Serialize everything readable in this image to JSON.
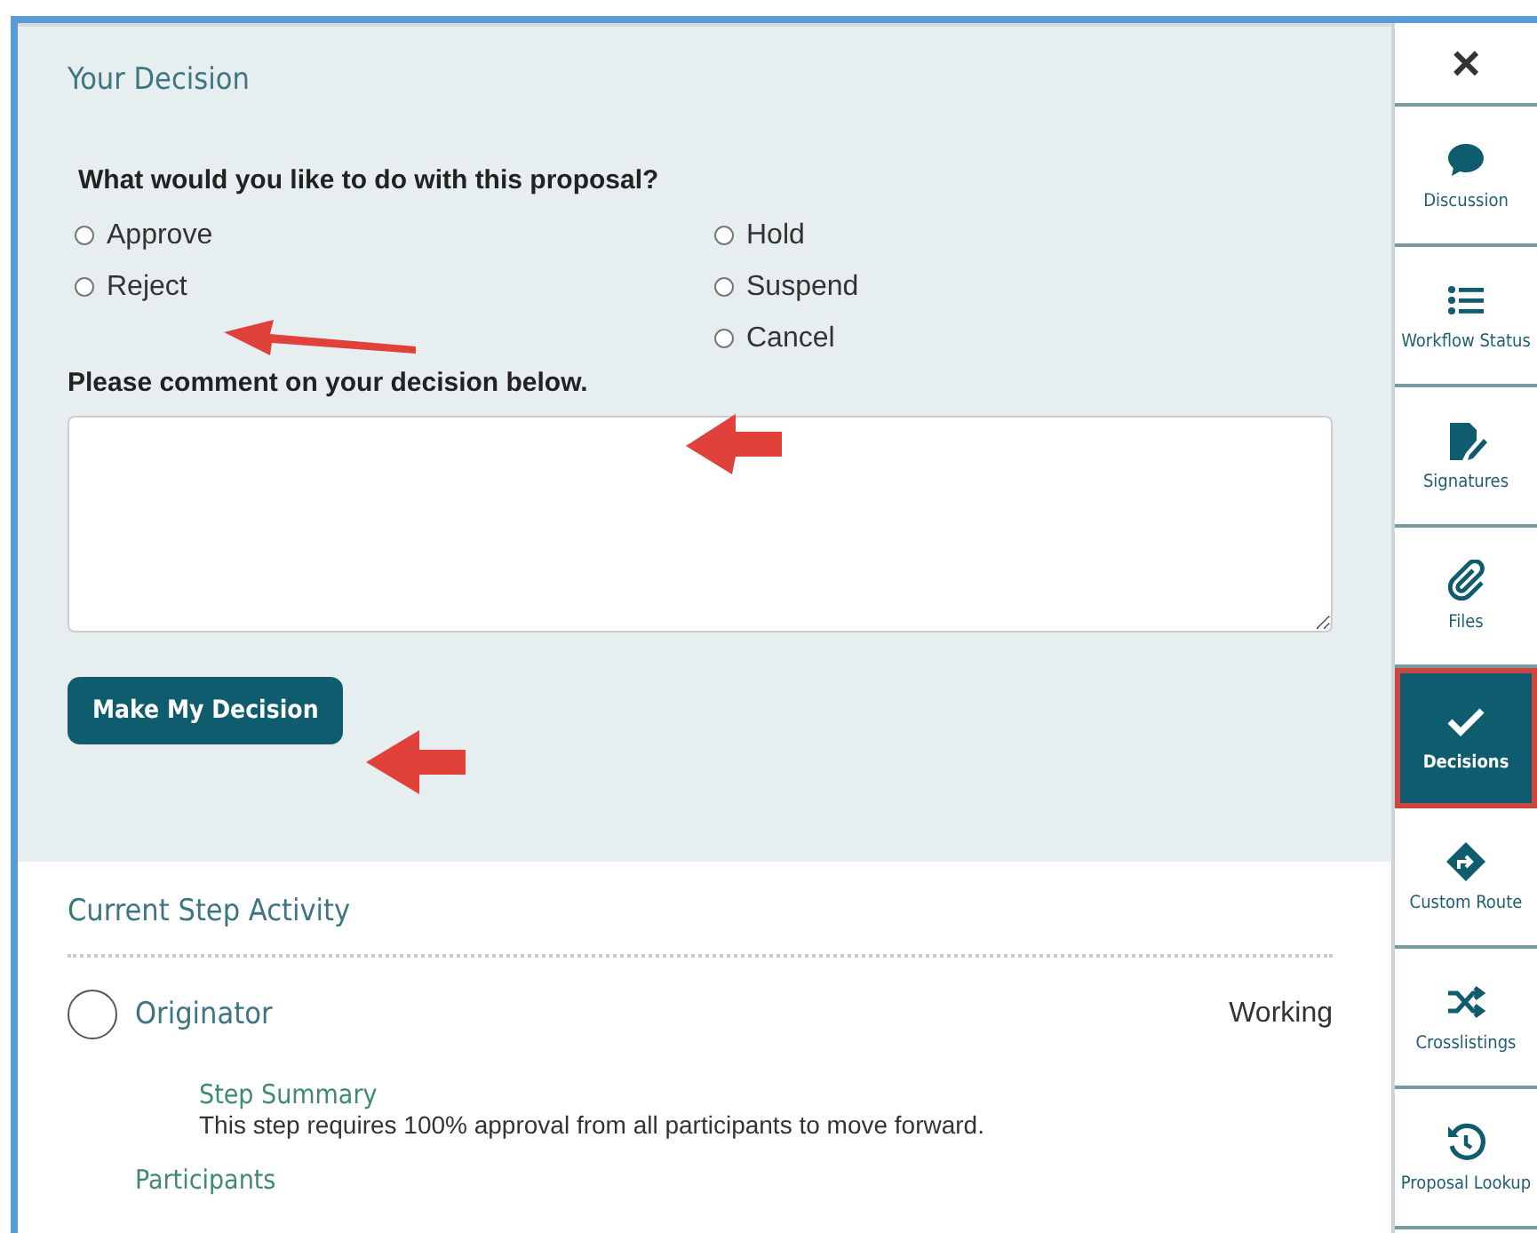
{
  "decision": {
    "title": "Your Decision",
    "question": "What would you like to do with this proposal?",
    "options": [
      {
        "label": "Approve",
        "selected": false
      },
      {
        "label": "Reject",
        "selected": false
      },
      {
        "label": "Hold",
        "selected": false
      },
      {
        "label": "Suspend",
        "selected": false
      },
      {
        "label": "Cancel",
        "selected": false
      }
    ],
    "comment_label": "Please comment on your decision below.",
    "button": "Make My Decision"
  },
  "activity": {
    "title": "Current Step Activity",
    "step": "Originator",
    "status": "Working",
    "summary_title": "Step Summary",
    "summary": "This step requires 100% approval from all participants to move forward.",
    "participants_title": "Participants"
  },
  "sidebar": {
    "close": "×",
    "items": [
      {
        "kind": "discussion",
        "label": "Discussion",
        "selected": false
      },
      {
        "kind": "workflow",
        "label": "Workflow Status",
        "selected": false
      },
      {
        "kind": "signatures",
        "label": "Signatures",
        "selected": false
      },
      {
        "kind": "files",
        "label": "Files",
        "selected": false
      },
      {
        "kind": "decisions",
        "label": "Decisions",
        "selected": true
      },
      {
        "kind": "route",
        "label": "Custom Route",
        "selected": false
      },
      {
        "kind": "crosslistings",
        "label": "Crosslistings",
        "selected": false
      },
      {
        "kind": "lookup",
        "label": "Proposal Lookup",
        "selected": false
      }
    ]
  }
}
